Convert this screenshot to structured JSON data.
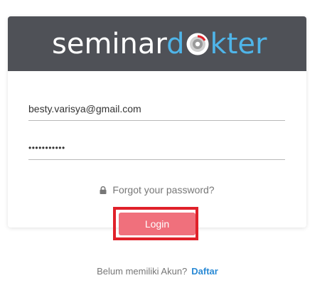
{
  "brand": {
    "logo_part1": "seminar",
    "logo_part2a": "d",
    "logo_part2b": "kter",
    "logo_icon": "disc-icon",
    "header_color": "#4f5157",
    "accent_color": "#4fb5e9"
  },
  "login_form": {
    "email_value": "besty.varisya@gmail.com",
    "password_masked": "•••••••••••",
    "forgot_icon": "lock-icon",
    "forgot_label": "Forgot your password?",
    "login_label": "Login",
    "login_color": "#f0707c",
    "highlight_color": "#e0212a"
  },
  "signup": {
    "prompt": "Belum memiliki Akun?",
    "link_label": "Daftar",
    "link_color": "#2a8ad5"
  }
}
